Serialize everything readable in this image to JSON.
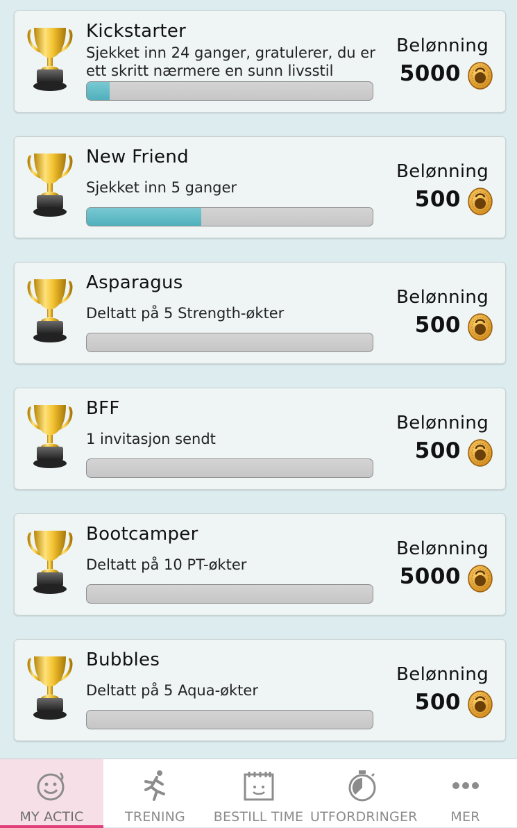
{
  "achievements": [
    {
      "title": "Kickstarter",
      "description": "Sjekket inn 24 ganger, gratulerer, du er ett skritt nærmere en sunn livsstil",
      "progress": 0.08,
      "reward_label": "Belønning",
      "reward_value": "5000"
    },
    {
      "title": "New Friend",
      "description": "Sjekket inn 5 ganger",
      "progress": 0.4,
      "reward_label": "Belønning",
      "reward_value": "500"
    },
    {
      "title": "Asparagus",
      "description": "Deltatt på 5 Strength-økter",
      "progress": 0,
      "reward_label": "Belønning",
      "reward_value": "500"
    },
    {
      "title": "BFF",
      "description": "1 invitasjon sendt",
      "progress": 0,
      "reward_label": "Belønning",
      "reward_value": "500"
    },
    {
      "title": "Bootcamper",
      "description": "Deltatt på 10 PT-økter",
      "progress": 0,
      "reward_label": "Belønning",
      "reward_value": "5000"
    },
    {
      "title": "Bubbles",
      "description": "Deltatt på 5 Aqua-økter",
      "progress": 0,
      "reward_label": "Belønning",
      "reward_value": "500"
    }
  ],
  "tabbar": {
    "tabs": [
      {
        "label": "MY ACTIC",
        "icon": "smiley-icon",
        "active": true
      },
      {
        "label": "TRENING",
        "icon": "runner-icon",
        "active": false
      },
      {
        "label": "BESTILL TIME",
        "icon": "calendar-icon",
        "active": false
      },
      {
        "label": "UTFORDRINGER",
        "icon": "stopwatch-icon",
        "active": false
      },
      {
        "label": "MER",
        "icon": "more-icon",
        "active": false
      }
    ]
  },
  "colors": {
    "progress": "#4fb0bc",
    "active_tab": "#e0407a",
    "background": "#dcecef"
  }
}
